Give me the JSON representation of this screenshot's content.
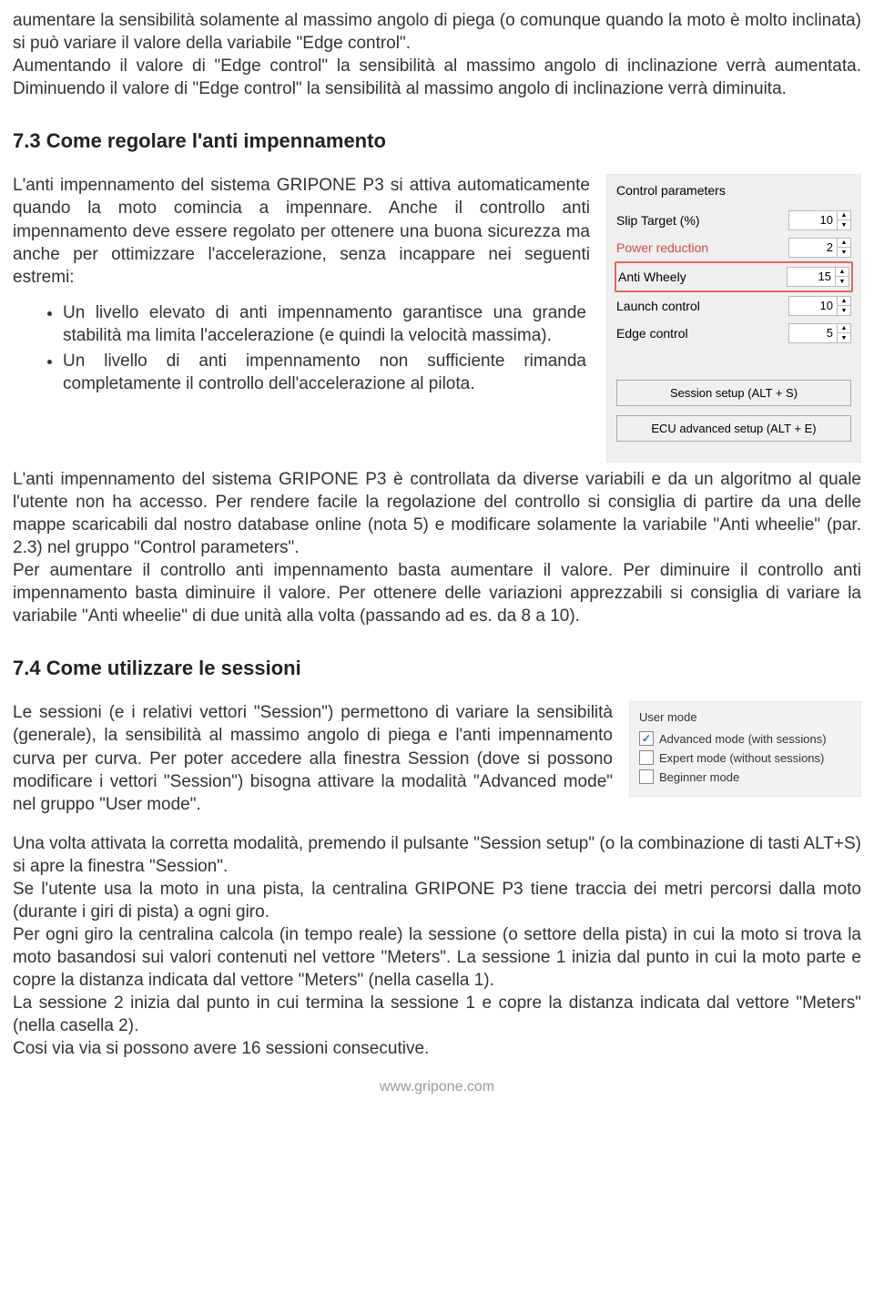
{
  "intro": {
    "p1": "aumentare la sensibilità solamente al massimo angolo di piega (o comunque quando la moto è molto inclinata) si può variare il valore della variabile \"Edge control\".",
    "p2": "Aumentando il valore di \"Edge control\" la sensibilità al massimo angolo di inclinazione verrà aumentata. Diminuendo il valore di \"Edge control\" la sensibilità al massimo angolo di inclinazione verrà diminuita."
  },
  "sec73": {
    "heading": "7.3 Come regolare l'anti impennamento",
    "p1": "L'anti impennamento del sistema GRIPONE P3 si attiva automaticamente quando la moto comincia a impennare. Anche il controllo anti impennamento deve essere regolato per ottenere una buona sicurezza ma anche per ottimizzare l'accelerazione, senza incappare nei seguenti estremi:",
    "b1": "Un livello elevato di anti impennamento garantisce una grande stabilità ma limita l'accelerazione (e quindi la velocità massima).",
    "b2": "Un livello di anti impennamento non sufficiente rimanda completamente il controllo dell'accelerazione al pilota.",
    "p2": "L'anti impennamento del sistema GRIPONE P3 è controllata da diverse variabili e da un algoritmo al quale l'utente non ha accesso. Per rendere facile la regolazione del controllo si consiglia di partire da una delle mappe scaricabili dal nostro database online (nota 5) e modificare solamente la variabile \"Anti wheelie\" (par. 2.3) nel gruppo \"Control parameters\".",
    "p3": "Per aumentare il controllo anti impennamento basta aumentare il valore. Per diminuire il controllo anti impennamento basta diminuire il valore. Per ottenere delle variazioni apprezzabili si consiglia di variare la variabile \"Anti wheelie\" di due unità alla volta (passando ad es. da 8 a 10)."
  },
  "panel": {
    "title": "Control parameters",
    "rows": {
      "slip": {
        "label": "Slip Target (%)",
        "value": "10"
      },
      "power": {
        "label": "Power reduction",
        "value": "2"
      },
      "wheely": {
        "label": "Anti Wheely",
        "value": "15"
      },
      "launch": {
        "label": "Launch control",
        "value": "10"
      },
      "edge": {
        "label": "Edge control",
        "value": "5"
      }
    },
    "btn1": "Session setup (ALT + S)",
    "btn2": "ECU advanced setup (ALT + E)"
  },
  "sec74": {
    "heading": "7.4 Come utilizzare le sessioni",
    "p1": " Le sessioni (e i relativi vettori \"Session\") permettono di variare la sensibilità (generale), la sensibilità al massimo angolo di piega e l'anti impennamento curva per curva. Per poter accedere alla finestra Session (dove si possono modificare i vettori \"Session\") bisogna attivare la modalità \"Advanced mode\" nel gruppo \"User mode\".",
    "p2": "Una volta attivata la corretta modalità, premendo il pulsante \"Session setup\" (o la combinazione di tasti ALT+S) si apre la finestra \"Session\".",
    "p3": "Se l'utente usa la moto in una pista, la centralina GRIPONE P3 tiene traccia dei metri percorsi dalla moto (durante i giri di pista) a ogni giro.",
    "p4": "Per ogni giro la centralina calcola (in tempo reale) la sessione (o settore della pista) in cui la moto si trova la moto basandosi sui valori contenuti nel vettore \"Meters\". La sessione 1 inizia dal punto in cui la moto parte e copre la distanza indicata dal vettore \"Meters\" (nella casella 1).",
    "p5": "La sessione 2 inizia dal punto in cui termina la sessione 1 e copre la distanza indicata dal vettore \"Meters\" (nella casella 2).",
    "p6": "Cosi via via si possono avere 16 sessioni consecutive."
  },
  "usermode": {
    "title": "User mode",
    "o1": "Advanced mode (with sessions)",
    "o2": "Expert mode (without sessions)",
    "o3": "Beginner mode"
  },
  "footer": "www.gripone.com"
}
